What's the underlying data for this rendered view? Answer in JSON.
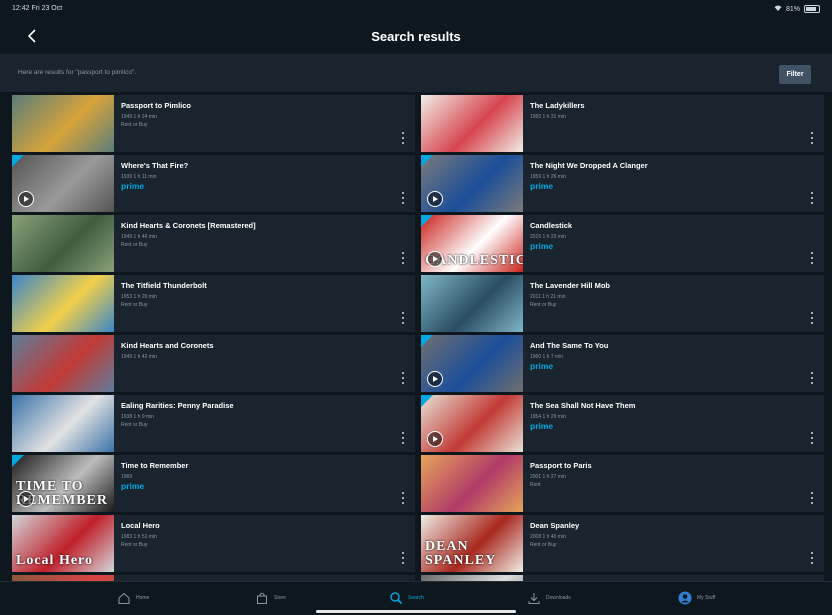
{
  "status": {
    "time": "12:42  Fri 23 Oct",
    "battery": "81%"
  },
  "header": {
    "title": "Search results"
  },
  "search": {
    "results_text": "Here are results for \"passport to pimlico\".",
    "filter_label": "Filter"
  },
  "results": [
    {
      "title": "Passport to Pimlico",
      "meta": "1949   1 h 24 min",
      "availability": "Rent or Buy",
      "prime": "",
      "thumb_bg": "#5b7d7a",
      "thumb_accent": "#d7a43a",
      "thumb_text": ""
    },
    {
      "title": "The Ladykillers",
      "meta": "1955   1 h 31 min",
      "availability": "",
      "prime": "",
      "thumb_bg": "#f1eee7",
      "thumb_accent": "#d6454f",
      "thumb_text": ""
    },
    {
      "title": "Where's That Fire?",
      "meta": "1939   1 h 11 min",
      "availability": "",
      "prime": "prime",
      "thumb_bg": "#545454",
      "thumb_accent": "#9a9a9a",
      "thumb_text": ""
    },
    {
      "title": "The Night We Dropped A Clanger",
      "meta": "1959   1 h 26 min",
      "availability": "",
      "prime": "prime",
      "thumb_bg": "#7a7a7a",
      "thumb_accent": "#1b4e9a",
      "thumb_text": ""
    },
    {
      "title": "Kind Hearts & Coronets [Remastered]",
      "meta": "1949   1 h 46 min",
      "availability": "Rent or Buy",
      "prime": "",
      "thumb_bg": "#8aa07a",
      "thumb_accent": "#3f5d3e",
      "thumb_text": ""
    },
    {
      "title": "Candlestick",
      "meta": "2015   1 h 23 min",
      "availability": "",
      "prime": "prime",
      "thumb_bg": "#c8211b",
      "thumb_accent": "#ffffff",
      "thumb_text": "CANDLESTICK"
    },
    {
      "title": "The Titfield Thunderbolt",
      "meta": "1953   1 h 20 min",
      "availability": "Rent or Buy",
      "prime": "",
      "thumb_bg": "#3a86c8",
      "thumb_accent": "#f2d04a",
      "thumb_text": ""
    },
    {
      "title": "The Lavender Hill Mob",
      "meta": "2011   1 h 21 min",
      "availability": "Rent or Buy",
      "prime": "",
      "thumb_bg": "#7fb7c7",
      "thumb_accent": "#2a4c62",
      "thumb_text": ""
    },
    {
      "title": "Kind Hearts and Coronets",
      "meta": "1949   1 h 42 min",
      "availability": "",
      "prime": "",
      "thumb_bg": "#5f7d9b",
      "thumb_accent": "#c23a35",
      "thumb_text": ""
    },
    {
      "title": "And The Same To You",
      "meta": "1960   1 h 7 min",
      "availability": "",
      "prime": "prime",
      "thumb_bg": "#707070",
      "thumb_accent": "#1b4e9a",
      "thumb_text": ""
    },
    {
      "title": "Ealing Rarities: Penny Paradise",
      "meta": "1938   1 h 9 min",
      "availability": "Rent or Buy",
      "prime": "",
      "thumb_bg": "#3b73a8",
      "thumb_accent": "#e2e2e2",
      "thumb_text": ""
    },
    {
      "title": "The Sea Shall Not Have Them",
      "meta": "1954   1 h 29 min",
      "availability": "",
      "prime": "prime",
      "thumb_bg": "#e8e2d6",
      "thumb_accent": "#c23a35",
      "thumb_text": ""
    },
    {
      "title": "Time to Remember",
      "meta": "1969",
      "availability": "",
      "prime": "prime",
      "thumb_bg": "#1b1b1b",
      "thumb_accent": "#bdbdbd",
      "thumb_text": "TIME TO REMEMBER"
    },
    {
      "title": "Passport to Paris",
      "meta": "2001   1 h 27 min",
      "availability": "Rent",
      "prime": "",
      "thumb_bg": "#e6a45a",
      "thumb_accent": "#b03a67",
      "thumb_text": ""
    },
    {
      "title": "Local Hero",
      "meta": "1983   1 h 51 min",
      "availability": "Rent or Buy",
      "prime": "",
      "thumb_bg": "#d2d7da",
      "thumb_accent": "#c0202a",
      "thumb_text": "Local Hero"
    },
    {
      "title": "Dean Spanley",
      "meta": "2008   1 h 40 min",
      "availability": "Rent or Buy",
      "prime": "",
      "thumb_bg": "#f0ede6",
      "thumb_accent": "#a8281e",
      "thumb_text": "DEAN SPANLEY"
    },
    {
      "title": "",
      "meta": "",
      "availability": "",
      "prime": "",
      "thumb_bg": "#8a5a3a",
      "thumb_accent": "#d44",
      "thumb_text": ""
    },
    {
      "title": "",
      "meta": "",
      "availability": "",
      "prime": "",
      "thumb_bg": "#6a6a6a",
      "thumb_accent": "#ddd",
      "thumb_text": ""
    }
  ],
  "tabs": [
    {
      "label": "Home",
      "icon": "home-icon",
      "active": false
    },
    {
      "label": "Store",
      "icon": "store-icon",
      "active": false
    },
    {
      "label": "Search",
      "icon": "search-icon",
      "active": true
    },
    {
      "label": "Downloads",
      "icon": "download-icon",
      "active": false
    },
    {
      "label": "My Stuff",
      "icon": "avatar-icon",
      "active": false
    }
  ],
  "colors": {
    "background": "#0f171e",
    "card": "#1a242f",
    "accent": "#00a8e1"
  }
}
